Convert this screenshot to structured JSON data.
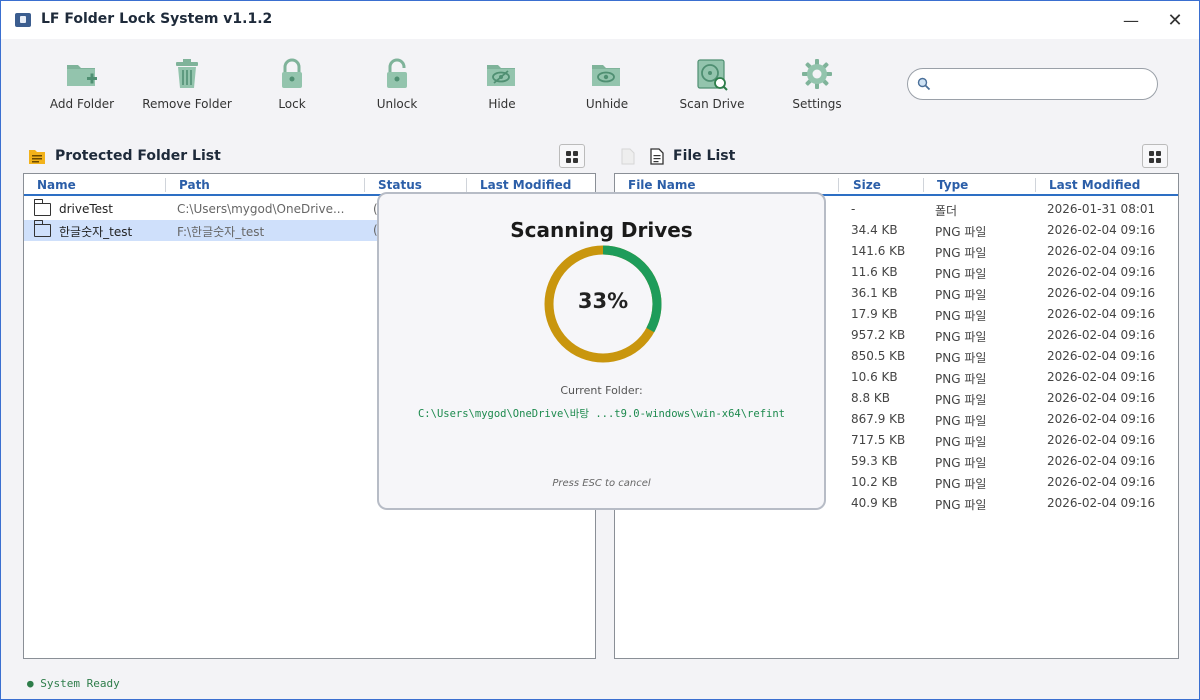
{
  "window": {
    "title": "LF Folder Lock System v1.1.2",
    "minimize": "—",
    "close": "✕"
  },
  "toolbar": {
    "add_folder": "Add Folder",
    "remove_folder": "Remove Folder",
    "lock": "Lock",
    "unlock": "Unlock",
    "hide": "Hide",
    "unhide": "Unhide",
    "scan_drive": "Scan Drive",
    "settings": "Settings"
  },
  "search": {
    "value": "",
    "placeholder": ""
  },
  "left_panel": {
    "title": "Protected Folder List",
    "columns": {
      "name": "Name",
      "path": "Path",
      "status": "Status",
      "modified": "Last Modified"
    },
    "rows": [
      {
        "name": "driveTest",
        "path": "C:\\Users\\mygod\\OneDrive...",
        "status": "("
      },
      {
        "name": "한글숫자_test",
        "path": "F:\\한글숫자_test",
        "status": "("
      }
    ]
  },
  "right_panel": {
    "title": "File List",
    "columns": {
      "name": "File Name",
      "size": "Size",
      "type": "Type",
      "modified": "Last Modified"
    },
    "rows": [
      {
        "size": "-",
        "type": "폴더",
        "modified": "2026-01-31 08:01"
      },
      {
        "size": "34.4 KB",
        "type": "PNG 파일",
        "modified": "2026-02-04 09:16"
      },
      {
        "size": "141.6 KB",
        "type": "PNG 파일",
        "modified": "2026-02-04 09:16"
      },
      {
        "size": "11.6 KB",
        "type": "PNG 파일",
        "modified": "2026-02-04 09:16"
      },
      {
        "size": "36.1 KB",
        "type": "PNG 파일",
        "modified": "2026-02-04 09:16"
      },
      {
        "size": "17.9 KB",
        "type": "PNG 파일",
        "modified": "2026-02-04 09:16"
      },
      {
        "size": "957.2 KB",
        "type": "PNG 파일",
        "modified": "2026-02-04 09:16"
      },
      {
        "size": "850.5 KB",
        "type": "PNG 파일",
        "modified": "2026-02-04 09:16"
      },
      {
        "size": "10.6 KB",
        "type": "PNG 파일",
        "modified": "2026-02-04 09:16"
      },
      {
        "size": "8.8 KB",
        "type": "PNG 파일",
        "modified": "2026-02-04 09:16"
      },
      {
        "size": "867.9 KB",
        "type": "PNG 파일",
        "modified": "2026-02-04 09:16"
      },
      {
        "size": "717.5 KB",
        "type": "PNG 파일",
        "modified": "2026-02-04 09:16"
      },
      {
        "size": "59.3 KB",
        "type": "PNG 파일",
        "modified": "2026-02-04 09:16"
      },
      {
        "size": "10.2 KB",
        "type": "PNG 파일",
        "modified": "2026-02-04 09:16"
      },
      {
        "size": "40.9 KB",
        "type": "PNG 파일",
        "modified": "2026-02-04 09:16"
      }
    ]
  },
  "scan_dialog": {
    "title": "Scanning Drives",
    "progress": 33,
    "progress_text": "33%",
    "current_label": "Current Folder:",
    "current_path": "C:\\Users\\mygod\\OneDrive\\바탕 ...t9.0-windows\\win-x64\\refint",
    "cancel_hint": "Press ESC to cancel"
  },
  "status": {
    "text": "● System Ready"
  },
  "colors": {
    "accent": "#2d6fc4",
    "header_text": "#2b5ea8",
    "selected_row": "#cfe0fb",
    "progress_done": "#1e9c5a",
    "progress_remaining": "#c9960e",
    "icon_green": "#7fb39a",
    "status_green": "#2e7d4a"
  },
  "icons": {
    "add_folder": "folder-plus-icon",
    "remove_folder": "trash-icon",
    "lock": "lock-icon",
    "unlock": "unlock-icon",
    "hide": "eye-off-icon",
    "unhide": "eye-icon",
    "scan_drive": "drive-scan-icon",
    "settings": "gear-icon",
    "search": "search-icon"
  }
}
